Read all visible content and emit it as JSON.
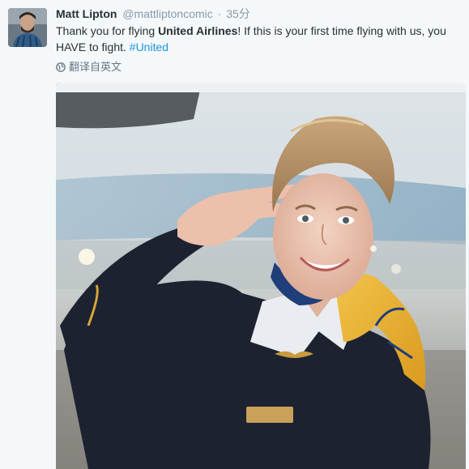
{
  "tweet": {
    "author_name": "Matt Lipton",
    "handle": "@mattliptoncomic",
    "separator": "·",
    "timestamp": "35分",
    "text_before": "Thank you for flying ",
    "text_bold": "United Airlines",
    "text_after": "! If this is your first time flying with us, you HAVE to fight. ",
    "hashtag": "#United",
    "translate_label": "翻译自英文"
  },
  "icons": {
    "translate": "globe-icon"
  },
  "colors": {
    "link": "#1b95e0",
    "name": "#292f33",
    "muted": "#8899a6",
    "background": "#f5f8fa"
  }
}
